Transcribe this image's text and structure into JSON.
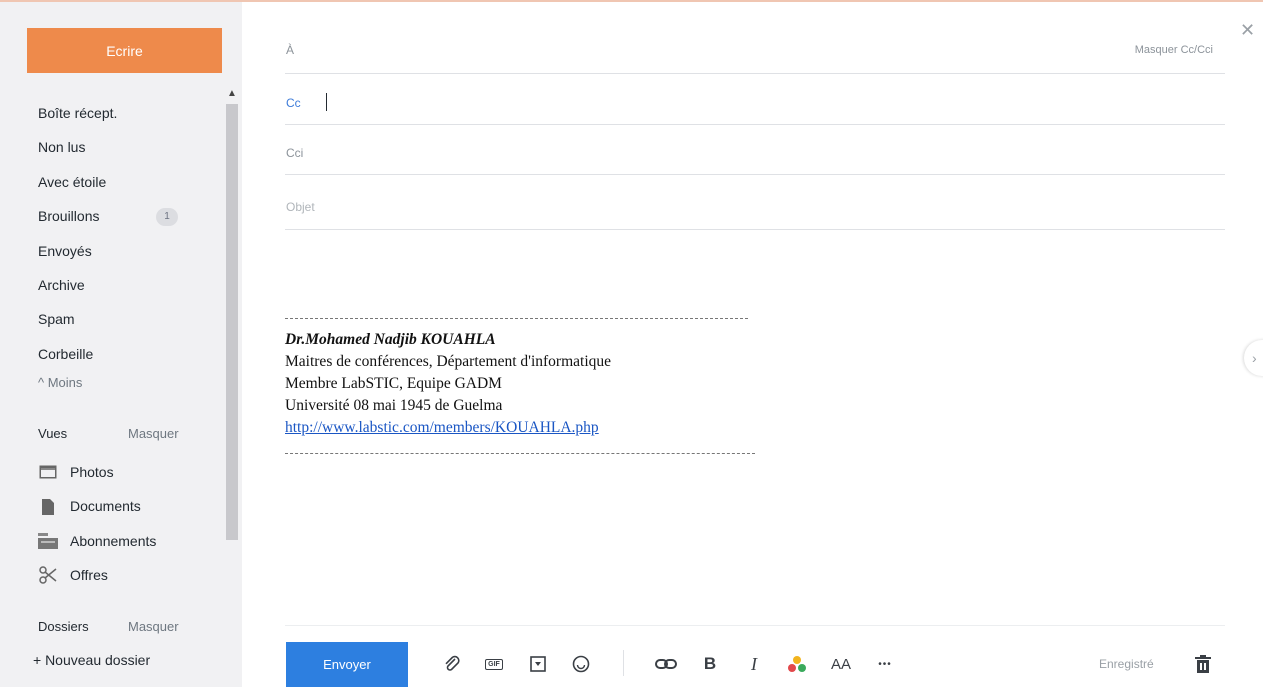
{
  "sidebar": {
    "compose_label": "Ecrire",
    "folders": [
      {
        "label": "Boîte récept."
      },
      {
        "label": "Non lus"
      },
      {
        "label": "Avec étoile"
      },
      {
        "label": "Brouillons",
        "badge": "1"
      },
      {
        "label": "Envoyés"
      },
      {
        "label": "Archive"
      },
      {
        "label": "Spam"
      },
      {
        "label": "Corbeille"
      }
    ],
    "less_label": "^ Moins",
    "views": {
      "title": "Vues",
      "hide_label": "Masquer",
      "items": [
        {
          "label": "Photos",
          "icon": "photo-icon"
        },
        {
          "label": "Documents",
          "icon": "document-icon"
        },
        {
          "label": "Abonnements",
          "icon": "subscriptions-icon"
        },
        {
          "label": "Offres",
          "icon": "scissors-icon"
        }
      ]
    },
    "folders_section": {
      "title": "Dossiers",
      "hide_label": "Masquer",
      "new_folder_label": "+ Nouveau dossier"
    }
  },
  "compose": {
    "to_label": "À",
    "toggle_cc_label": "Masquer Cc/Cci",
    "cc_label": "Cc",
    "bcc_label": "Cci",
    "subject_placeholder": "Objet",
    "signature": {
      "rule_top": "----------------------------------------------------------------------------",
      "name": "Dr.Mohamed Nadjib KOUAHLA",
      "line1": "Maitres de conférences, Département d'informatique",
      "line2": "Membre LabSTIC, Equipe GADM",
      "line3": "Université 08 mai 1945 de Guelma",
      "link": "http://www.labstic.com/members/KOUAHLA.php"
    }
  },
  "toolbar": {
    "send_label": "Envoyer",
    "saved_label": "Enregistré",
    "gif_label": "GIF",
    "bold_label": "B",
    "italic_label": "I",
    "font_size_label": "AA",
    "more_label": "•••"
  },
  "colors": {
    "compose_button": "#ee8a4b",
    "send_button": "#2d7fe0",
    "link": "#1a56c4"
  }
}
